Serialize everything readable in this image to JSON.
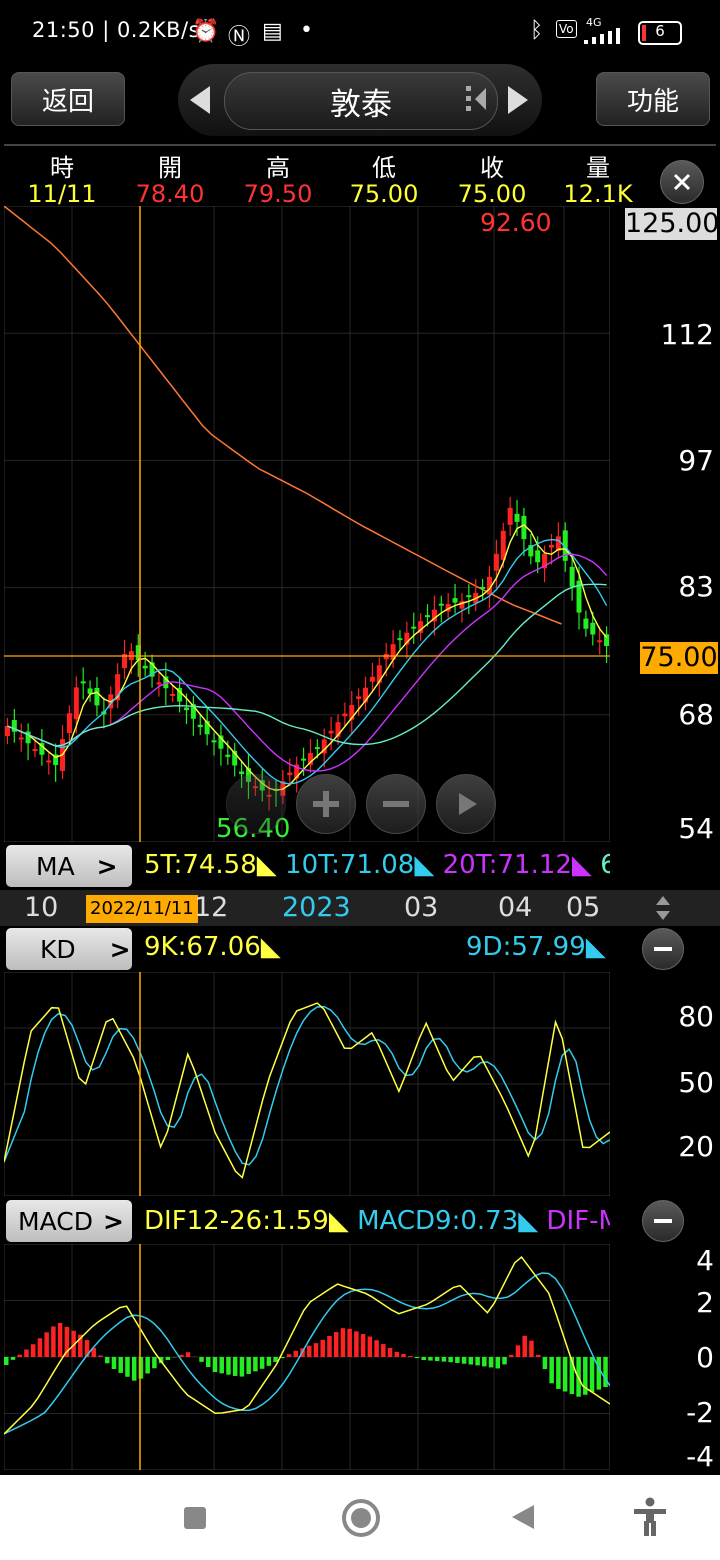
{
  "status_bar": {
    "time_speed": "21:50 | 0.2KB/s",
    "battery": "6",
    "network": "4G"
  },
  "header": {
    "back_label": "返回",
    "title": "敦泰",
    "function_label": "功能"
  },
  "quote": {
    "headers": [
      "時",
      "開",
      "高",
      "低",
      "收",
      "量"
    ],
    "values": [
      "11/11",
      "78.40",
      "79.50",
      "75.00",
      "75.00",
      "12.1K"
    ],
    "value_colors": [
      "#ffff33",
      "#ff3333",
      "#ff3333",
      "#ffff33",
      "#ffff33",
      "#ffff33"
    ],
    "extra_value": "92.60"
  },
  "price_axis": {
    "max_label": "125.00",
    "ticks": [
      "112",
      "97",
      "83",
      "68",
      "54"
    ],
    "current_price": "75.00",
    "low_label": "56.40"
  },
  "ma_bar": {
    "button": "MA",
    "ma5": "5T:74.58",
    "ma10": "10T:71.08",
    "ma20": "20T:71.12",
    "overflow": "6"
  },
  "time_axis": {
    "labels": [
      "10",
      "12",
      "2023",
      "03",
      "04",
      "05"
    ],
    "cursor_date": "2022/11/11"
  },
  "kd_bar": {
    "button": "KD",
    "k": "9K:67.06",
    "d": "9D:57.99",
    "ticks": [
      "80",
      "50",
      "20"
    ]
  },
  "macd_bar": {
    "button": "MACD",
    "dif": "DIF12-26:1.59",
    "macd": "MACD9:0.73",
    "osc": "DIF-M",
    "ticks": [
      "4",
      "2",
      "0",
      "-2",
      "-4"
    ]
  },
  "colors": {
    "up": "#ff2222",
    "down": "#22ee22",
    "ma5": "#ffff44",
    "ma10": "#33ccee",
    "ma20": "#cc33ff",
    "ma60": "#66eecc",
    "long_ma": "#ff7733",
    "cursor": "#ffaa00"
  },
  "icons": {
    "zoom_in": "plus-icon",
    "zoom_out": "minus-icon",
    "play": "play-icon",
    "close": "close-icon",
    "nav_recent": "square-icon",
    "nav_home": "circle-icon",
    "nav_back": "triangle-back-icon",
    "accessibility": "accessibility-icon"
  }
}
